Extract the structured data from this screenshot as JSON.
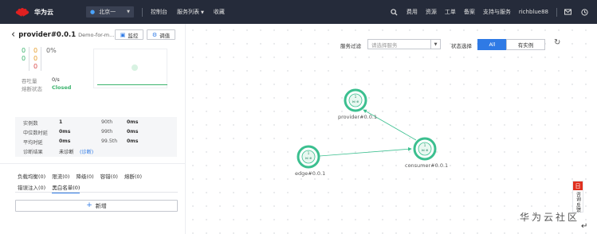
{
  "topbar": {
    "brand": "华为云",
    "region": "北京一",
    "nav": [
      "控制台",
      "服务列表",
      "收藏"
    ],
    "right_links": [
      "费用",
      "资源",
      "工单",
      "备案",
      "支持与服务",
      "richblue88"
    ]
  },
  "service": {
    "name": "provider#0.0.1",
    "desc": "Demo-for-m...",
    "monitor_button": "监控",
    "governance_button": "调值"
  },
  "stats": {
    "success": [
      "0",
      "0"
    ],
    "warn": [
      "0",
      "0"
    ],
    "error": "0",
    "percent": "0%",
    "throughput_label": "吞吐量",
    "throughput_value": "0/s",
    "breaker_label": "熔断状态",
    "breaker_value": "Closed"
  },
  "metrics": {
    "instances_label": "实例数",
    "instances_value": "1",
    "p90_label": "90th",
    "p90_value": "0ms",
    "median_label": "中位数时延",
    "median_value": "0ms",
    "p99_label": "99th",
    "p99_value": "0ms",
    "avg_label": "平均时延",
    "avg_value": "0ms",
    "p995_label": "99.5th",
    "p995_value": "0ms",
    "diagnosis_label": "诊断结果",
    "diagnosis_value": "未诊断",
    "diagnosis_link": "(诊断)"
  },
  "tabs": {
    "row1": [
      "负载均衡(0)",
      "限流(0)",
      "降级(0)",
      "容错(0)",
      "熔断(0)"
    ],
    "row2": [
      "错误注入(0)",
      "黑白名单(0)"
    ],
    "active": "黑白名单(0)"
  },
  "add_button": "新增",
  "filter": {
    "service_filter_label": "服务过滤",
    "service_placeholder": "请选择服务",
    "status_label": "状态选择",
    "status_options": [
      "All",
      "有实例"
    ],
    "status_selected": "All"
  },
  "topology": {
    "nodes": [
      {
        "id": "provider",
        "label": "provider#0.0.1"
      },
      {
        "id": "edge",
        "label": "edge#0.0.1"
      },
      {
        "id": "consumer",
        "label": "consumer#0.0.1"
      }
    ],
    "edges": [
      {
        "from": "edge",
        "to": "consumer"
      },
      {
        "from": "consumer",
        "to": "provider"
      }
    ]
  },
  "float_panel": {
    "icon": "日",
    "text": "咨询·反馈"
  },
  "watermark": "华为云社区",
  "colors": {
    "accent": "#2f7ae5",
    "node": "#3bbf8f",
    "topbar": "#252b3a",
    "ok": "#3bb36d"
  }
}
